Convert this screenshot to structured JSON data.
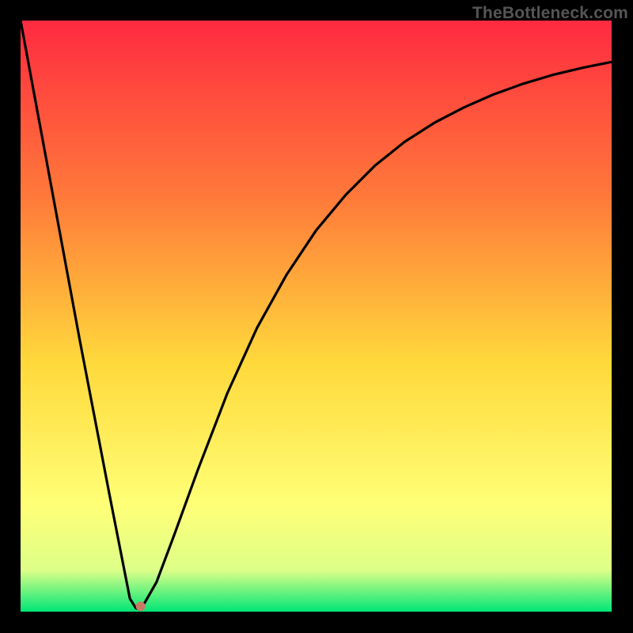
{
  "watermark": "TheBottleneck.com",
  "gradient": {
    "top": "#ff2a40",
    "mid1": "#ff7a3a",
    "mid2": "#ffd93b",
    "mid3": "#ffff77",
    "mid4": "#ddff88",
    "bottom": "#00e676"
  },
  "chart_data": {
    "type": "line",
    "title": "",
    "xlabel": "",
    "ylabel": "",
    "xlim": [
      0,
      100
    ],
    "ylim": [
      0,
      100
    ],
    "series": [
      {
        "name": "curve",
        "x": [
          0,
          5,
          10,
          15,
          18.5,
          19.5,
          20,
          21,
          23,
          26,
          30,
          35,
          40,
          45,
          50,
          55,
          60,
          65,
          70,
          75,
          80,
          85,
          90,
          95,
          100
        ],
        "values": [
          100,
          73,
          46,
          20,
          2.2,
          0.6,
          0.4,
          1.5,
          5,
          13,
          24,
          37,
          48,
          57,
          64.5,
          70.5,
          75.5,
          79.5,
          82.7,
          85.3,
          87.5,
          89.3,
          90.8,
          92,
          93
        ]
      }
    ],
    "marker": {
      "x": 20.3,
      "y": 0.9,
      "color": "#c97966"
    }
  }
}
